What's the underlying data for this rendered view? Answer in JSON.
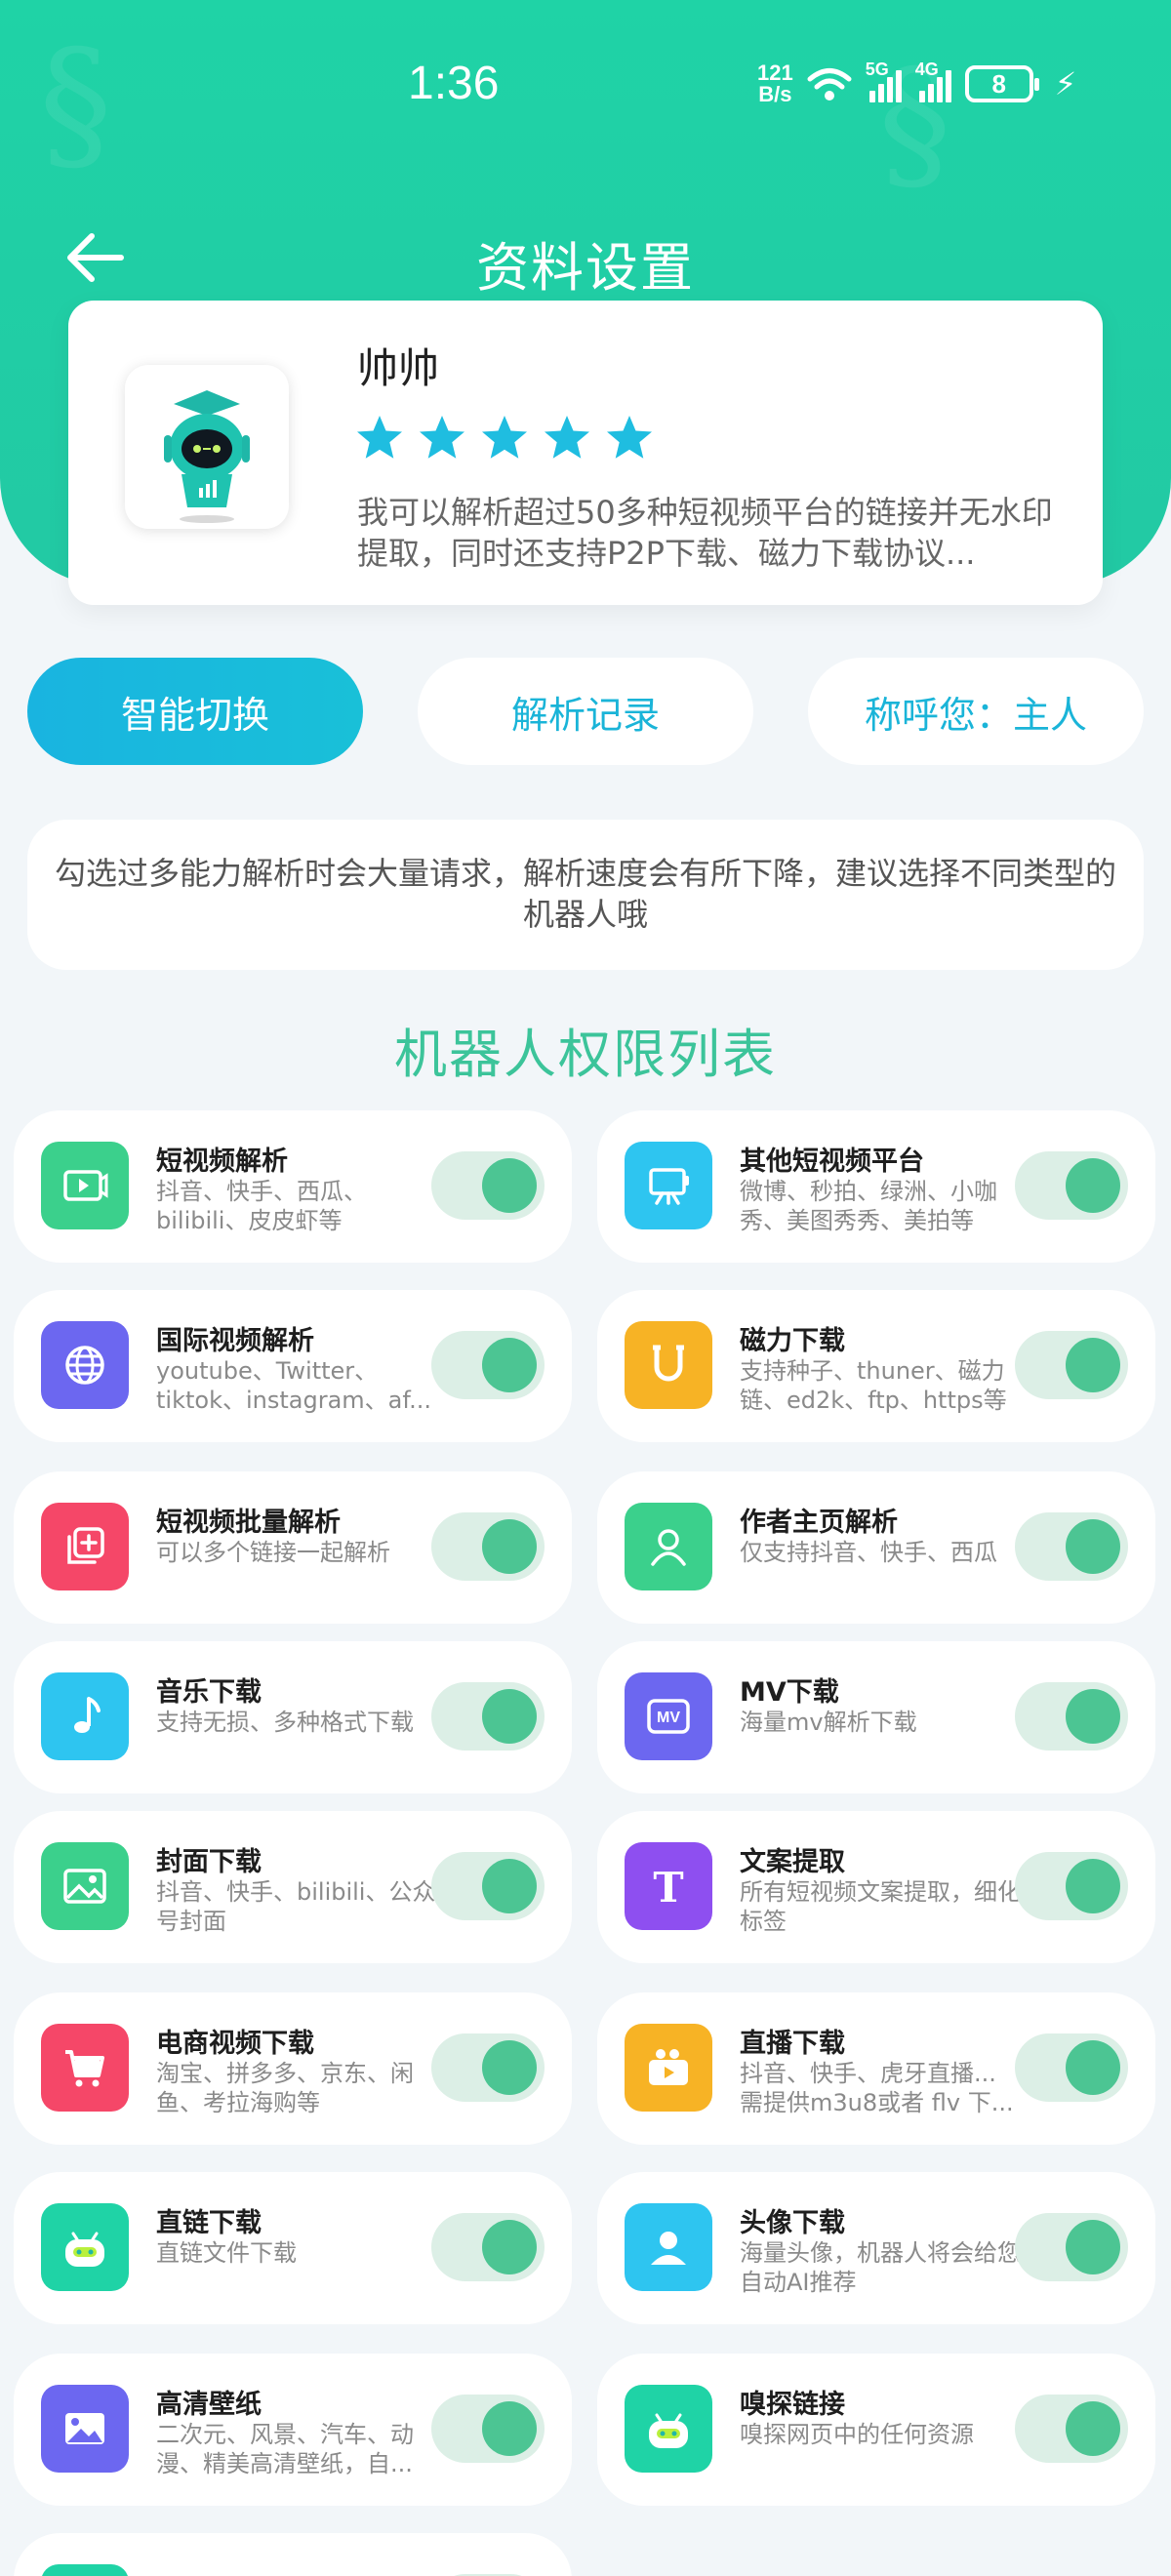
{
  "status_bar": {
    "time": "1:36",
    "speed_value": "121",
    "speed_unit": "B/s",
    "net1": "5G",
    "net2": "4G",
    "battery": "8"
  },
  "nav": {
    "title": "资料设置"
  },
  "profile": {
    "name": "帅帅",
    "rating_stars": 5,
    "description": "我可以解析超过50多种短视频平台的链接并无水印提取，同时还支持P2P下载、磁力下载协议..."
  },
  "tabs": [
    {
      "label": "智能切换",
      "active": true
    },
    {
      "label": "解析记录",
      "active": false
    },
    {
      "label": "称呼您：主人",
      "active": false
    }
  ],
  "notice": "勾选过多能力解析时会大量请求，解析速度会有所下降，建议选择不同类型的机器人哦",
  "section_title": "机器人权限列表",
  "permissions": [
    {
      "title": "短视频解析",
      "desc": "抖音、快手、西瓜、bilibili、皮皮虾等",
      "icon": "video-play-icon",
      "color": "#3bd08c",
      "enabled": true
    },
    {
      "title": "其他短视频平台",
      "desc": "微博、秒拍、绿洲、小咖秀、美图秀秀、美拍等",
      "icon": "screen-stand-icon",
      "color": "#2ec5f0",
      "enabled": true
    },
    {
      "title": "国际视频解析",
      "desc": "youtube、Twitter、tiktok、instagram、af...",
      "icon": "globe-icon",
      "color": "#6c67f0",
      "enabled": true
    },
    {
      "title": "磁力下载",
      "desc": "支持种子、thuner、磁力链、ed2k、ftp、https等",
      "icon": "magnet-icon",
      "color": "#f7b325",
      "enabled": true
    },
    {
      "title": "短视频批量解析",
      "desc": "可以多个链接一起解析",
      "icon": "batch-add-icon",
      "color": "#f54768",
      "enabled": true
    },
    {
      "title": "作者主页解析",
      "desc": "仅支持抖音、快手、西瓜",
      "icon": "user-icon",
      "color": "#3bd08c",
      "enabled": true
    },
    {
      "title": "音乐下载",
      "desc": "支持无损、多种格式下载",
      "icon": "music-note-icon",
      "color": "#2ec5f0",
      "enabled": true
    },
    {
      "title": "MV下载",
      "desc": "海量mv解析下载",
      "icon": "mv-icon",
      "color": "#6c67f0",
      "enabled": true
    },
    {
      "title": "封面下载",
      "desc": "抖音、快手、bilibili、公众号封面",
      "icon": "image-icon",
      "color": "#3bd08c",
      "enabled": true
    },
    {
      "title": "文案提取",
      "desc": "所有短视频文案提取，细化标签",
      "icon": "text-t-icon",
      "color": "#8e4ff0",
      "enabled": true
    },
    {
      "title": "电商视频下载",
      "desc": "淘宝、拼多多、京东、闲鱼、考拉海购等",
      "icon": "cart-icon",
      "color": "#f54768",
      "enabled": true
    },
    {
      "title": "直播下载",
      "desc": "抖音、快手、虎牙直播... 需提供m3u8或者 flv 下...",
      "icon": "camera-icon",
      "color": "#f7b325",
      "enabled": true
    },
    {
      "title": "直链下载",
      "desc": "直链文件下载",
      "icon": "robot-icon",
      "color": "#1fd3a6",
      "enabled": true
    },
    {
      "title": "头像下载",
      "desc": "海量头像，机器人将会给您自动AI推荐",
      "icon": "avatar-icon",
      "color": "#2ec5f0",
      "enabled": true
    },
    {
      "title": "高清壁纸",
      "desc": "二次元、风景、汽车、动漫、精美高清壁纸，自...",
      "icon": "wallpaper-icon",
      "color": "#6c67f0",
      "enabled": true
    },
    {
      "title": "嗅探链接",
      "desc": "嗅探网页中的任何资源",
      "icon": "robot-icon",
      "color": "#1fd3a6",
      "enabled": true
    },
    {
      "title": "",
      "desc": "",
      "icon": "robot-icon",
      "color": "#1fd3a6",
      "enabled": true
    }
  ]
}
